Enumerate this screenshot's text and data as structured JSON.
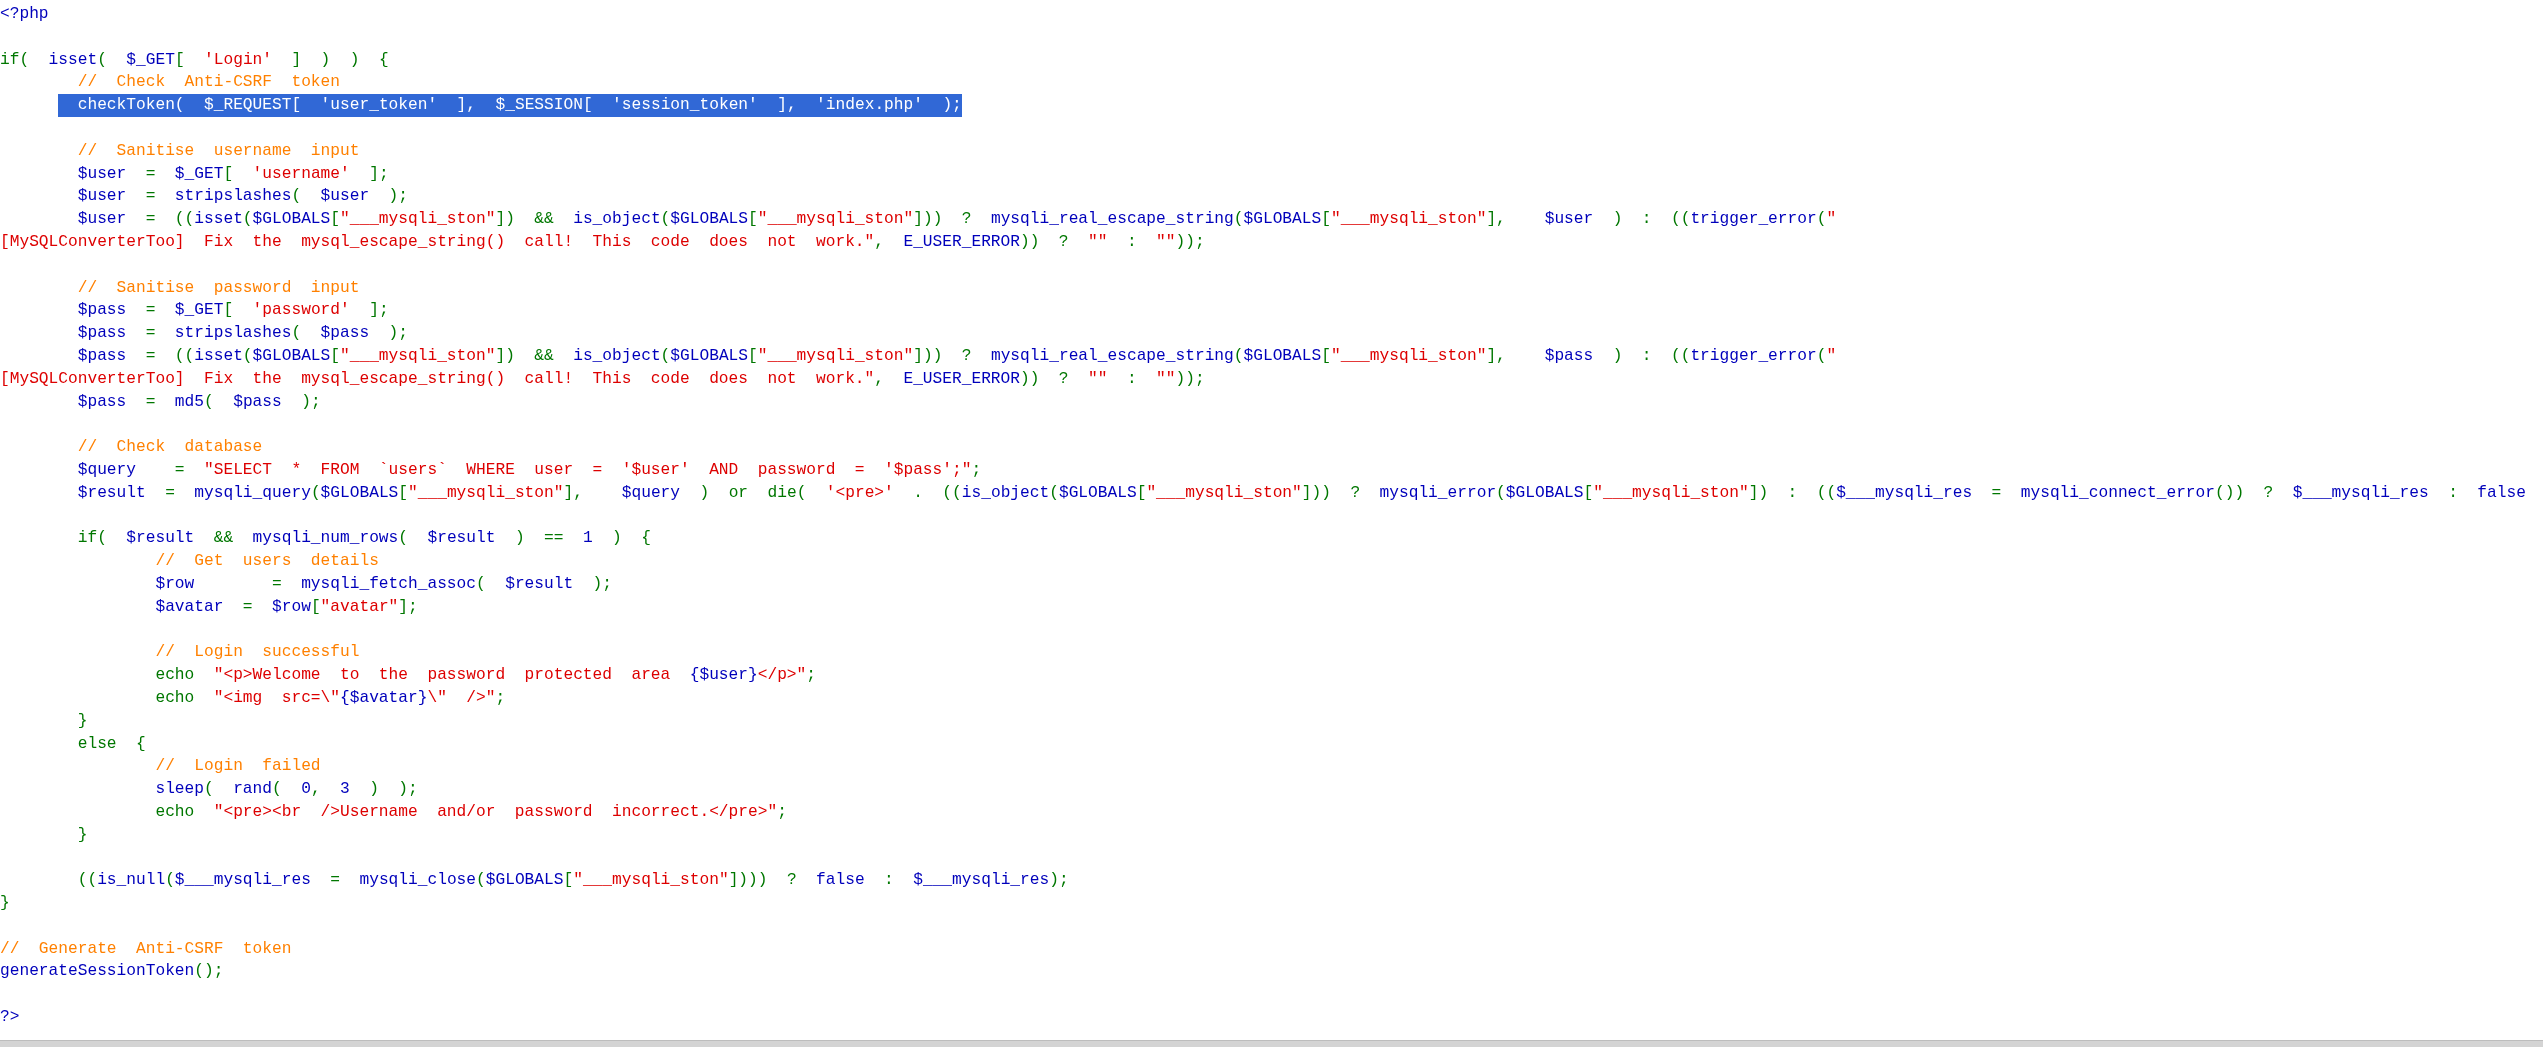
{
  "source_lines": [
    {
      "kind": "code",
      "selected": false,
      "tokens": [
        {
          "kind": "default",
          "text": "<?php"
        }
      ]
    },
    {
      "kind": "blank"
    },
    {
      "kind": "code",
      "selected": false,
      "tokens": [
        {
          "kind": "keyword",
          "text": "if(  "
        },
        {
          "kind": "default",
          "text": "isset"
        },
        {
          "kind": "keyword",
          "text": "(  "
        },
        {
          "kind": "default",
          "text": "$_GET"
        },
        {
          "kind": "keyword",
          "text": "[  "
        },
        {
          "kind": "string",
          "text": "'Login'"
        },
        {
          "kind": "keyword",
          "text": "  ]  )  )  {"
        }
      ],
      "children": [
        {
          "kind": "code",
          "selected": false,
          "tokens": [
            {
              "kind": "comment",
              "text": "//  Check  Anti-CSRF  token"
            }
          ]
        },
        {
          "kind": "code",
          "selected": true,
          "tokens": [
            {
              "kind": "default",
              "text": "checkToken"
            },
            {
              "kind": "keyword",
              "text": "(  "
            },
            {
              "kind": "default",
              "text": "$_REQUEST"
            },
            {
              "kind": "keyword",
              "text": "[  "
            },
            {
              "kind": "string",
              "text": "'user_token'"
            },
            {
              "kind": "keyword",
              "text": "  ],  "
            },
            {
              "kind": "default",
              "text": "$_SESSION"
            },
            {
              "kind": "keyword",
              "text": "[  "
            },
            {
              "kind": "string",
              "text": "'session_token'"
            },
            {
              "kind": "keyword",
              "text": "  ],  "
            },
            {
              "kind": "string",
              "text": "'index.php'"
            },
            {
              "kind": "keyword",
              "text": "  );"
            }
          ]
        },
        {
          "kind": "blank"
        },
        {
          "kind": "code",
          "selected": false,
          "tokens": [
            {
              "kind": "comment",
              "text": "//  Sanitise  username  input"
            }
          ]
        },
        {
          "kind": "code",
          "selected": false,
          "tokens": [
            {
              "kind": "default",
              "text": "$user  "
            },
            {
              "kind": "keyword",
              "text": "=  "
            },
            {
              "kind": "default",
              "text": "$_GET"
            },
            {
              "kind": "keyword",
              "text": "[  "
            },
            {
              "kind": "string",
              "text": "'username'"
            },
            {
              "kind": "keyword",
              "text": "  ];"
            }
          ]
        },
        {
          "kind": "code",
          "selected": false,
          "tokens": [
            {
              "kind": "default",
              "text": "$user  "
            },
            {
              "kind": "keyword",
              "text": "=  "
            },
            {
              "kind": "default",
              "text": "stripslashes"
            },
            {
              "kind": "keyword",
              "text": "(  "
            },
            {
              "kind": "default",
              "text": "$user  "
            },
            {
              "kind": "keyword",
              "text": ");"
            }
          ]
        },
        {
          "kind": "code",
          "selected": false,
          "tokens": [
            {
              "kind": "default",
              "text": "$user  "
            },
            {
              "kind": "keyword",
              "text": "=  (("
            },
            {
              "kind": "default",
              "text": "isset"
            },
            {
              "kind": "keyword",
              "text": "("
            },
            {
              "kind": "default",
              "text": "$GLOBALS"
            },
            {
              "kind": "keyword",
              "text": "["
            },
            {
              "kind": "string",
              "text": "\"___mysqli_ston\""
            },
            {
              "kind": "keyword",
              "text": "])  &&  "
            },
            {
              "kind": "default",
              "text": "is_object"
            },
            {
              "kind": "keyword",
              "text": "("
            },
            {
              "kind": "default",
              "text": "$GLOBALS"
            },
            {
              "kind": "keyword",
              "text": "["
            },
            {
              "kind": "string",
              "text": "\"___mysqli_ston\""
            },
            {
              "kind": "keyword",
              "text": "]))  ?  "
            },
            {
              "kind": "default",
              "text": "mysqli_real_escape_string"
            },
            {
              "kind": "keyword",
              "text": "("
            },
            {
              "kind": "default",
              "text": "$GLOBALS"
            },
            {
              "kind": "keyword",
              "text": "["
            },
            {
              "kind": "string",
              "text": "\"___mysqli_ston\""
            },
            {
              "kind": "keyword",
              "text": "],    "
            },
            {
              "kind": "default",
              "text": "$user  "
            },
            {
              "kind": "keyword",
              "text": ")  :  (("
            },
            {
              "kind": "default",
              "text": "trigger_error"
            },
            {
              "kind": "keyword",
              "text": "("
            },
            {
              "kind": "string",
              "text": "\""
            }
          ]
        },
        {
          "kind": "wrap",
          "selected": false,
          "tokens": [
            {
              "kind": "string",
              "text": "[MySQLConverterToo]  Fix  the  mysql_escape_string()  call!  This  code  does  not  work.\""
            },
            {
              "kind": "keyword",
              "text": ",  "
            },
            {
              "kind": "default",
              "text": "E_USER_ERROR"
            },
            {
              "kind": "keyword",
              "text": "))  ?  "
            },
            {
              "kind": "string",
              "text": "\"\""
            },
            {
              "kind": "keyword",
              "text": "  :  "
            },
            {
              "kind": "string",
              "text": "\"\""
            },
            {
              "kind": "keyword",
              "text": "));"
            }
          ]
        },
        {
          "kind": "blank"
        },
        {
          "kind": "code",
          "selected": false,
          "tokens": [
            {
              "kind": "comment",
              "text": "//  Sanitise  password  input"
            }
          ]
        },
        {
          "kind": "code",
          "selected": false,
          "tokens": [
            {
              "kind": "default",
              "text": "$pass  "
            },
            {
              "kind": "keyword",
              "text": "=  "
            },
            {
              "kind": "default",
              "text": "$_GET"
            },
            {
              "kind": "keyword",
              "text": "[  "
            },
            {
              "kind": "string",
              "text": "'password'"
            },
            {
              "kind": "keyword",
              "text": "  ];"
            }
          ]
        },
        {
          "kind": "code",
          "selected": false,
          "tokens": [
            {
              "kind": "default",
              "text": "$pass  "
            },
            {
              "kind": "keyword",
              "text": "=  "
            },
            {
              "kind": "default",
              "text": "stripslashes"
            },
            {
              "kind": "keyword",
              "text": "(  "
            },
            {
              "kind": "default",
              "text": "$pass  "
            },
            {
              "kind": "keyword",
              "text": ");"
            }
          ]
        },
        {
          "kind": "code",
          "selected": false,
          "tokens": [
            {
              "kind": "default",
              "text": "$pass  "
            },
            {
              "kind": "keyword",
              "text": "=  (("
            },
            {
              "kind": "default",
              "text": "isset"
            },
            {
              "kind": "keyword",
              "text": "("
            },
            {
              "kind": "default",
              "text": "$GLOBALS"
            },
            {
              "kind": "keyword",
              "text": "["
            },
            {
              "kind": "string",
              "text": "\"___mysqli_ston\""
            },
            {
              "kind": "keyword",
              "text": "])  &&  "
            },
            {
              "kind": "default",
              "text": "is_object"
            },
            {
              "kind": "keyword",
              "text": "("
            },
            {
              "kind": "default",
              "text": "$GLOBALS"
            },
            {
              "kind": "keyword",
              "text": "["
            },
            {
              "kind": "string",
              "text": "\"___mysqli_ston\""
            },
            {
              "kind": "keyword",
              "text": "]))  ?  "
            },
            {
              "kind": "default",
              "text": "mysqli_real_escape_string"
            },
            {
              "kind": "keyword",
              "text": "("
            },
            {
              "kind": "default",
              "text": "$GLOBALS"
            },
            {
              "kind": "keyword",
              "text": "["
            },
            {
              "kind": "string",
              "text": "\"___mysqli_ston\""
            },
            {
              "kind": "keyword",
              "text": "],    "
            },
            {
              "kind": "default",
              "text": "$pass  "
            },
            {
              "kind": "keyword",
              "text": ")  :  (("
            },
            {
              "kind": "default",
              "text": "trigger_error"
            },
            {
              "kind": "keyword",
              "text": "("
            },
            {
              "kind": "string",
              "text": "\""
            }
          ]
        },
        {
          "kind": "wrap",
          "selected": false,
          "tokens": [
            {
              "kind": "string",
              "text": "[MySQLConverterToo]  Fix  the  mysql_escape_string()  call!  This  code  does  not  work.\""
            },
            {
              "kind": "keyword",
              "text": ",  "
            },
            {
              "kind": "default",
              "text": "E_USER_ERROR"
            },
            {
              "kind": "keyword",
              "text": "))  ?  "
            },
            {
              "kind": "string",
              "text": "\"\""
            },
            {
              "kind": "keyword",
              "text": "  :  "
            },
            {
              "kind": "string",
              "text": "\"\""
            },
            {
              "kind": "keyword",
              "text": "));"
            }
          ]
        },
        {
          "kind": "code",
          "selected": false,
          "tokens": [
            {
              "kind": "default",
              "text": "$pass  "
            },
            {
              "kind": "keyword",
              "text": "=  "
            },
            {
              "kind": "default",
              "text": "md5"
            },
            {
              "kind": "keyword",
              "text": "(  "
            },
            {
              "kind": "default",
              "text": "$pass  "
            },
            {
              "kind": "keyword",
              "text": ");"
            }
          ]
        },
        {
          "kind": "blank"
        },
        {
          "kind": "code",
          "selected": false,
          "tokens": [
            {
              "kind": "comment",
              "text": "//  Check  database"
            }
          ]
        },
        {
          "kind": "code",
          "selected": false,
          "tokens": [
            {
              "kind": "default",
              "text": "$query    "
            },
            {
              "kind": "keyword",
              "text": "=  "
            },
            {
              "kind": "string",
              "text": "\"SELECT  *  FROM  `users`  WHERE  user  =  '$user'  AND  password  =  '$pass';\""
            },
            {
              "kind": "keyword",
              "text": ";"
            }
          ]
        },
        {
          "kind": "code",
          "selected": false,
          "tokens": [
            {
              "kind": "default",
              "text": "$result  "
            },
            {
              "kind": "keyword",
              "text": "=  "
            },
            {
              "kind": "default",
              "text": "mysqli_query"
            },
            {
              "kind": "keyword",
              "text": "("
            },
            {
              "kind": "default",
              "text": "$GLOBALS"
            },
            {
              "kind": "keyword",
              "text": "["
            },
            {
              "kind": "string",
              "text": "\"___mysqli_ston\""
            },
            {
              "kind": "keyword",
              "text": "],    "
            },
            {
              "kind": "default",
              "text": "$query  "
            },
            {
              "kind": "keyword",
              "text": ")  or  die(  "
            },
            {
              "kind": "string",
              "text": "'<pre>'"
            },
            {
              "kind": "keyword",
              "text": "  .  (("
            },
            {
              "kind": "default",
              "text": "is_object"
            },
            {
              "kind": "keyword",
              "text": "("
            },
            {
              "kind": "default",
              "text": "$GLOBALS"
            },
            {
              "kind": "keyword",
              "text": "["
            },
            {
              "kind": "string",
              "text": "\"___mysqli_ston\""
            },
            {
              "kind": "keyword",
              "text": "]))  ?  "
            },
            {
              "kind": "default",
              "text": "mysqli_error"
            },
            {
              "kind": "keyword",
              "text": "("
            },
            {
              "kind": "default",
              "text": "$GLOBALS"
            },
            {
              "kind": "keyword",
              "text": "["
            },
            {
              "kind": "string",
              "text": "\"___mysqli_ston\""
            },
            {
              "kind": "keyword",
              "text": "])  :  (("
            },
            {
              "kind": "default",
              "text": "$___mysqli_res  "
            },
            {
              "kind": "keyword",
              "text": "=  "
            },
            {
              "kind": "default",
              "text": "mysqli_connect_error"
            },
            {
              "kind": "keyword",
              "text": "())  ?  "
            },
            {
              "kind": "default",
              "text": "$___mysqli_res  "
            },
            {
              "kind": "keyword",
              "text": ":  "
            },
            {
              "kind": "default",
              "text": "false"
            }
          ]
        },
        {
          "kind": "blank"
        },
        {
          "kind": "code",
          "selected": false,
          "tokens": [
            {
              "kind": "keyword",
              "text": "if(  "
            },
            {
              "kind": "default",
              "text": "$result  "
            },
            {
              "kind": "keyword",
              "text": "&&  "
            },
            {
              "kind": "default",
              "text": "mysqli_num_rows"
            },
            {
              "kind": "keyword",
              "text": "(  "
            },
            {
              "kind": "default",
              "text": "$result  "
            },
            {
              "kind": "keyword",
              "text": ")  ==  "
            },
            {
              "kind": "default",
              "text": "1  "
            },
            {
              "kind": "keyword",
              "text": ")  {"
            }
          ],
          "children": [
            {
              "kind": "code",
              "selected": false,
              "tokens": [
                {
                  "kind": "comment",
                  "text": "//  Get  users  details"
                }
              ]
            },
            {
              "kind": "code",
              "selected": false,
              "tokens": [
                {
                  "kind": "default",
                  "text": "$row        "
                },
                {
                  "kind": "keyword",
                  "text": "=  "
                },
                {
                  "kind": "default",
                  "text": "mysqli_fetch_assoc"
                },
                {
                  "kind": "keyword",
                  "text": "(  "
                },
                {
                  "kind": "default",
                  "text": "$result  "
                },
                {
                  "kind": "keyword",
                  "text": ");"
                }
              ]
            },
            {
              "kind": "code",
              "selected": false,
              "tokens": [
                {
                  "kind": "default",
                  "text": "$avatar  "
                },
                {
                  "kind": "keyword",
                  "text": "=  "
                },
                {
                  "kind": "default",
                  "text": "$row"
                },
                {
                  "kind": "keyword",
                  "text": "["
                },
                {
                  "kind": "string",
                  "text": "\"avatar\""
                },
                {
                  "kind": "keyword",
                  "text": "];"
                }
              ]
            },
            {
              "kind": "blank"
            },
            {
              "kind": "code",
              "selected": false,
              "tokens": [
                {
                  "kind": "comment",
                  "text": "//  Login  successful"
                }
              ]
            },
            {
              "kind": "code",
              "selected": false,
              "tokens": [
                {
                  "kind": "keyword",
                  "text": "echo  "
                },
                {
                  "kind": "string",
                  "text": "\"<p>Welcome  to  the  password  protected  area  "
                },
                {
                  "kind": "default",
                  "text": "{$user}"
                },
                {
                  "kind": "string",
                  "text": "</p>\""
                },
                {
                  "kind": "keyword",
                  "text": ";"
                }
              ]
            },
            {
              "kind": "code",
              "selected": false,
              "tokens": [
                {
                  "kind": "keyword",
                  "text": "echo  "
                },
                {
                  "kind": "string",
                  "text": "\"<img  src=\\\""
                },
                {
                  "kind": "default",
                  "text": "{$avatar}"
                },
                {
                  "kind": "string",
                  "text": "\\\"  />\""
                },
                {
                  "kind": "keyword",
                  "text": ";"
                }
              ]
            }
          ]
        },
        {
          "kind": "code",
          "selected": false,
          "tokens": [
            {
              "kind": "keyword",
              "text": "}"
            }
          ]
        },
        {
          "kind": "code",
          "selected": false,
          "tokens": [
            {
              "kind": "keyword",
              "text": "else  {"
            }
          ],
          "children": [
            {
              "kind": "code",
              "selected": false,
              "tokens": [
                {
                  "kind": "comment",
                  "text": "//  Login  failed"
                }
              ]
            },
            {
              "kind": "code",
              "selected": false,
              "tokens": [
                {
                  "kind": "default",
                  "text": "sleep"
                },
                {
                  "kind": "keyword",
                  "text": "(  "
                },
                {
                  "kind": "default",
                  "text": "rand"
                },
                {
                  "kind": "keyword",
                  "text": "(  "
                },
                {
                  "kind": "default",
                  "text": "0"
                },
                {
                  "kind": "keyword",
                  "text": ",  "
                },
                {
                  "kind": "default",
                  "text": "3  "
                },
                {
                  "kind": "keyword",
                  "text": ")  );"
                }
              ]
            },
            {
              "kind": "code",
              "selected": false,
              "tokens": [
                {
                  "kind": "keyword",
                  "text": "echo  "
                },
                {
                  "kind": "string",
                  "text": "\"<pre><br  />Username  and/or  password  incorrect.</pre>\""
                },
                {
                  "kind": "keyword",
                  "text": ";"
                }
              ]
            }
          ]
        },
        {
          "kind": "code",
          "selected": false,
          "tokens": [
            {
              "kind": "keyword",
              "text": "}"
            }
          ]
        },
        {
          "kind": "blank"
        },
        {
          "kind": "code",
          "selected": false,
          "tokens": [
            {
              "kind": "keyword",
              "text": "(("
            },
            {
              "kind": "default",
              "text": "is_null"
            },
            {
              "kind": "keyword",
              "text": "("
            },
            {
              "kind": "default",
              "text": "$___mysqli_res  "
            },
            {
              "kind": "keyword",
              "text": "=  "
            },
            {
              "kind": "default",
              "text": "mysqli_close"
            },
            {
              "kind": "keyword",
              "text": "("
            },
            {
              "kind": "default",
              "text": "$GLOBALS"
            },
            {
              "kind": "keyword",
              "text": "["
            },
            {
              "kind": "string",
              "text": "\"___mysqli_ston\""
            },
            {
              "kind": "keyword",
              "text": "])))  ?  "
            },
            {
              "kind": "default",
              "text": "false  "
            },
            {
              "kind": "keyword",
              "text": ":  "
            },
            {
              "kind": "default",
              "text": "$___mysqli_res"
            },
            {
              "kind": "keyword",
              "text": ");"
            }
          ]
        }
      ]
    },
    {
      "kind": "code",
      "selected": false,
      "tokens": [
        {
          "kind": "keyword",
          "text": "}"
        }
      ]
    },
    {
      "kind": "blank"
    },
    {
      "kind": "code",
      "selected": false,
      "tokens": [
        {
          "kind": "comment",
          "text": "//  Generate  Anti-CSRF  token"
        }
      ]
    },
    {
      "kind": "code",
      "selected": false,
      "tokens": [
        {
          "kind": "default",
          "text": "generateSessionToken"
        },
        {
          "kind": "keyword",
          "text": "();"
        }
      ]
    },
    {
      "kind": "blank"
    },
    {
      "kind": "code",
      "selected": false,
      "tokens": [
        {
          "kind": "default",
          "text": "?>"
        }
      ]
    }
  ]
}
